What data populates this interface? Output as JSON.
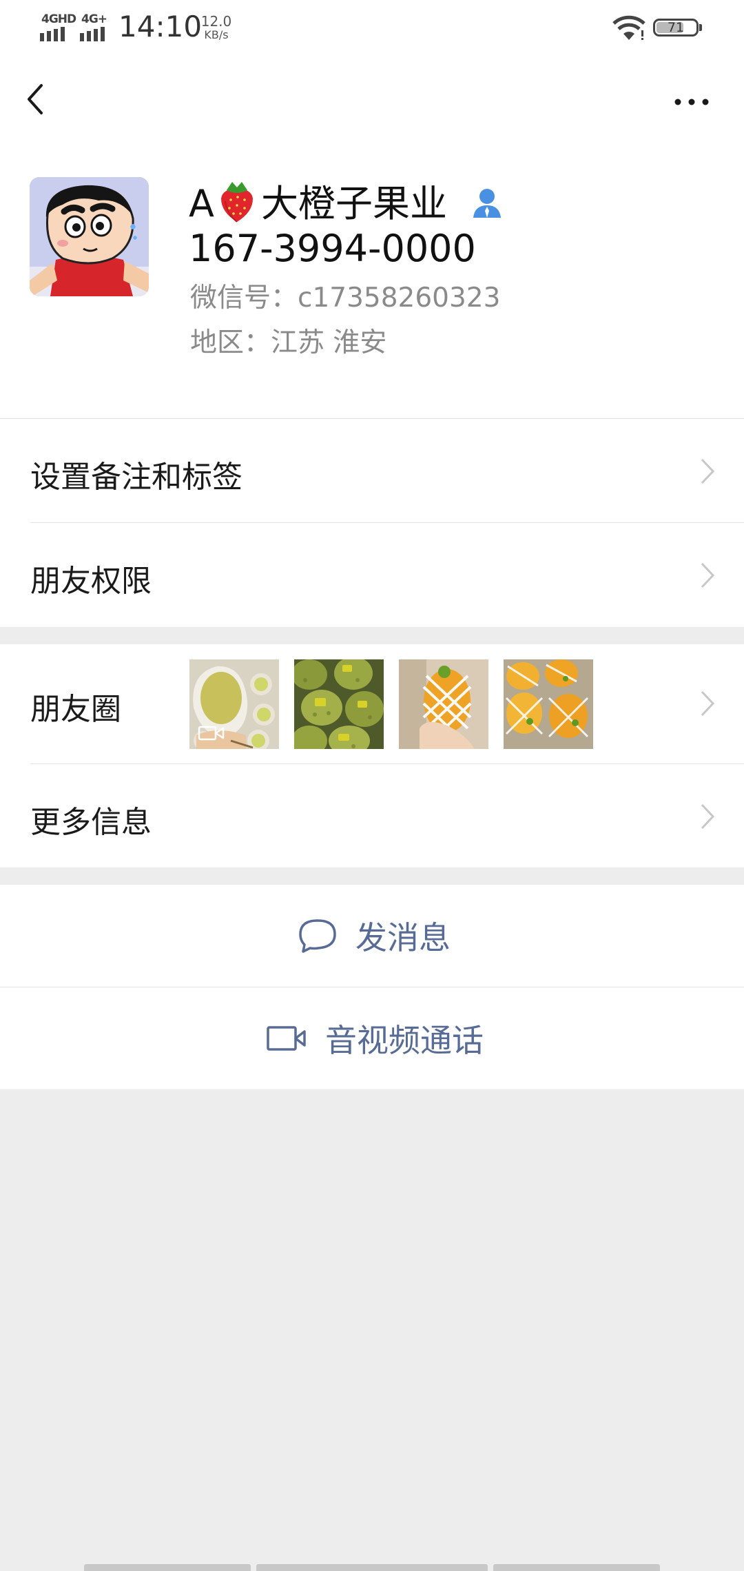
{
  "status_bar": {
    "sim1": "4GHD",
    "sim2": "4G+",
    "time": "14:10",
    "net_speed_value": "12.0",
    "net_speed_unit": "KB/s",
    "battery": "71",
    "battery_level_percent": 71,
    "icons": [
      "signal-icon",
      "wifi-icon",
      "battery-icon"
    ]
  },
  "nav": {
    "back_icon": "chevron-left-icon",
    "more_icon": "more-dots-icon"
  },
  "profile": {
    "name_prefix": "A",
    "name_emoji": "strawberry",
    "name_suffix": "大橙子果业",
    "contact_badge_icon": "contact-person-icon",
    "phone": "167-3994-0000",
    "wechat_id": "微信号：c17358260323",
    "region": "地区：江苏  淮安"
  },
  "cells": {
    "remark_tags": "设置备注和标签",
    "permissions": "朋友权限",
    "moments": "朋友圈",
    "more_info": "更多信息"
  },
  "moments": {
    "thumbnails": [
      {
        "name": "moment-thumb-1",
        "subject": "green fruit in white foam netting",
        "has_video_icon": true
      },
      {
        "name": "moment-thumb-2",
        "subject": "durians"
      },
      {
        "name": "moment-thumb-3",
        "subject": "mango in foam net held in hand"
      },
      {
        "name": "moment-thumb-4",
        "subject": "mangoes in foam netting"
      }
    ]
  },
  "actions": {
    "message": "发消息",
    "message_icon": "chat-bubble-icon",
    "video_call": "音视频通话",
    "video_call_icon": "video-camera-icon"
  },
  "colors": {
    "background": "#ededed",
    "card": "#ffffff",
    "link_blue": "#576b95",
    "secondary_text": "#8a8a8a",
    "contact_badge": "#4a90e2"
  }
}
